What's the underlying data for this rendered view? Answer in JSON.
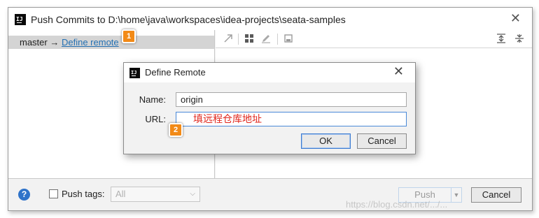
{
  "window": {
    "title": "Push Commits to D:\\home\\java\\workspaces\\idea-projects\\seata-samples",
    "app_icon": "IJ",
    "close_glyph": "✕"
  },
  "branch": {
    "name": "master",
    "arrow": "→",
    "link_label": "Define remote"
  },
  "toolbar_icons": [
    "arrow-move-icon",
    "grid-icon",
    "edit-pencil-icon",
    "save-icon",
    "expand-all-icon",
    "collapse-all-icon"
  ],
  "bottom": {
    "help_glyph": "?",
    "push_tags_label": "Push tags:",
    "tags_select_value": "All",
    "push_label": "Push",
    "cancel_label": "Cancel",
    "watermark": "https://blog.csdn.net/.../..."
  },
  "dialog": {
    "title": "Define Remote",
    "close_glyph": "✕",
    "name_label": "Name:",
    "name_value": "origin",
    "url_label": "URL:",
    "url_value": "填远程仓库地址",
    "ok_label": "OK",
    "cancel_label": "Cancel"
  },
  "badges": {
    "first": "1",
    "second": "2"
  },
  "colors": {
    "accent": "#f28a17",
    "link": "#2470b3",
    "annotation_text": "#e0261c",
    "focus": "#4a89d8"
  }
}
